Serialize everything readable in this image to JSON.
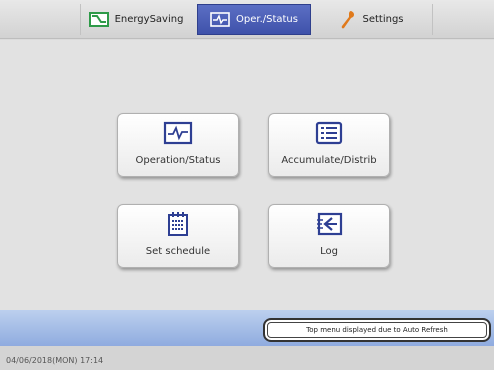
{
  "tabs": {
    "energy": {
      "label": "EnergySaving",
      "icon": "energy-saving-icon"
    },
    "oper": {
      "label": "Oper./Status",
      "icon": "pulse-monitor-icon",
      "active": true
    },
    "settings": {
      "label": "Settings",
      "icon": "wrench-icon"
    }
  },
  "menu": {
    "operation": {
      "label": "Operation/Status",
      "icon": "pulse-monitor-icon"
    },
    "accumulate": {
      "label": "Accumulate/Distrib",
      "icon": "list-icon"
    },
    "schedule": {
      "label": "Set schedule",
      "icon": "calendar-icon"
    },
    "log": {
      "label": "Log",
      "icon": "log-icon"
    }
  },
  "status": {
    "notice": "Top menu displayed due to Auto Refresh",
    "datetime": "04/06/2018(MON) 17:14"
  },
  "colors": {
    "active_tab": "#4a5db6",
    "icon_blue": "#2e3f93",
    "status_band": "#a3bbe6",
    "energy_green": "#2e9a48",
    "settings_orange": "#e07a1c"
  }
}
